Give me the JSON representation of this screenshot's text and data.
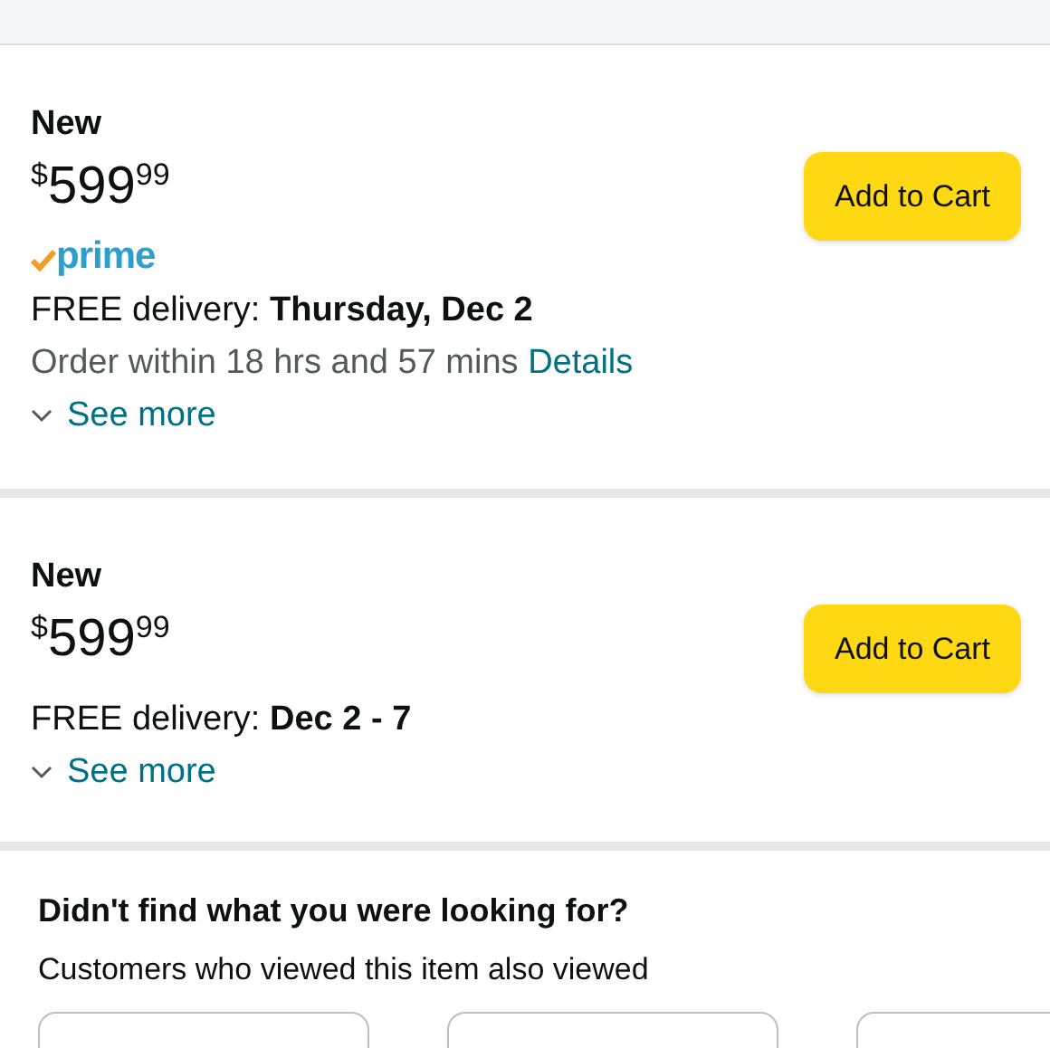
{
  "offers": [
    {
      "condition": "New",
      "price": {
        "currency": "$",
        "whole": "599",
        "fraction": "99"
      },
      "prime": true,
      "prime_label": "prime",
      "delivery": "FREE delivery: **Thursday, Dec 2**",
      "order_note": "Order within 18 hrs and 57 mins",
      "details_link": "Details",
      "see_more": "See more",
      "button": "Add to Cart"
    },
    {
      "condition": "New",
      "price": {
        "currency": "$",
        "whole": "599",
        "fraction": "99"
      },
      "prime": false,
      "delivery": "FREE delivery: **Dec 2 - 7**",
      "see_more": "See more",
      "button": "Add to Cart"
    }
  ],
  "recommendations": {
    "title": "Didn't find what you were looking for?",
    "subtitle": "Customers who viewed this item also viewed"
  }
}
